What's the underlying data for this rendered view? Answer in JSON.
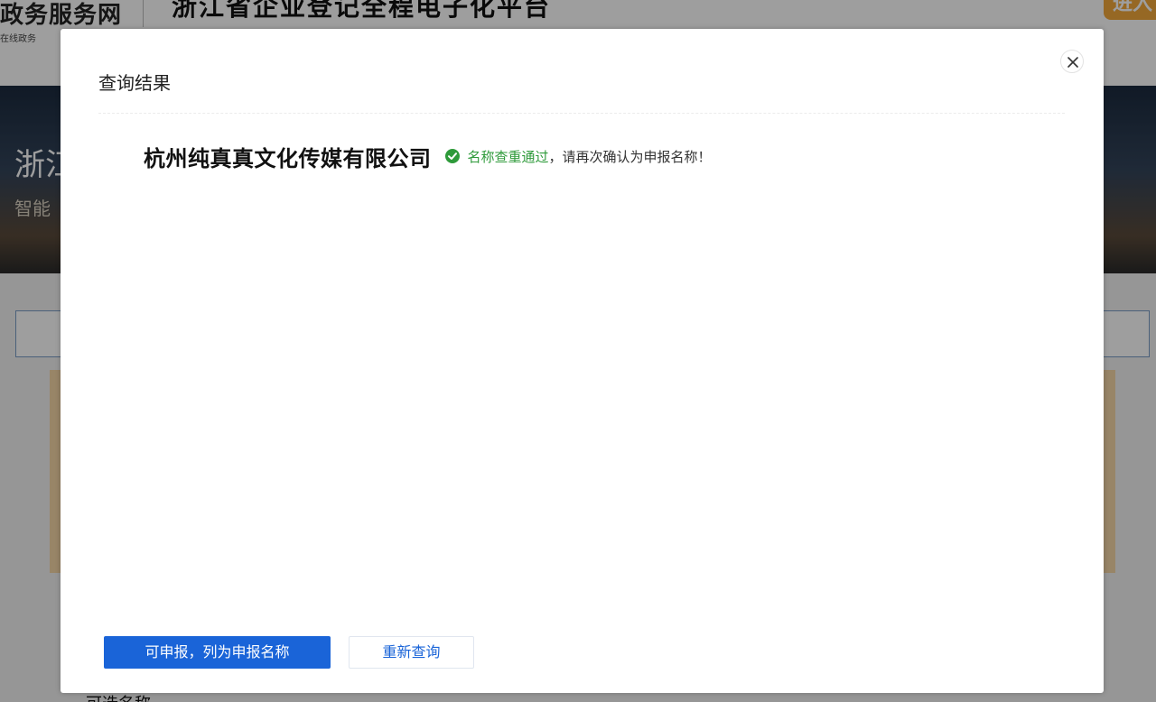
{
  "background": {
    "portal_name": "政务服务网",
    "portal_subtitle": "在线政务",
    "platform_title": "浙江省企业登记全程电子化平台",
    "login_label": "进入",
    "banner_title": "浙江",
    "banner_subtitle": "智能",
    "bottom_text": "可选名称"
  },
  "dialog": {
    "title": "查询结果",
    "close_icon": "close-icon",
    "company_name": "杭州纯真真文化传媒有限公司",
    "status_icon": "check-circle-icon",
    "status_pass_text": "名称查重通过",
    "status_rest_text": "，请再次确认为申报名称！",
    "status_color": "#2e9a3a",
    "primary_button_label": "可申报，列为申报名称",
    "secondary_button_label": "重新查询",
    "accent_color": "#1a64d8"
  }
}
